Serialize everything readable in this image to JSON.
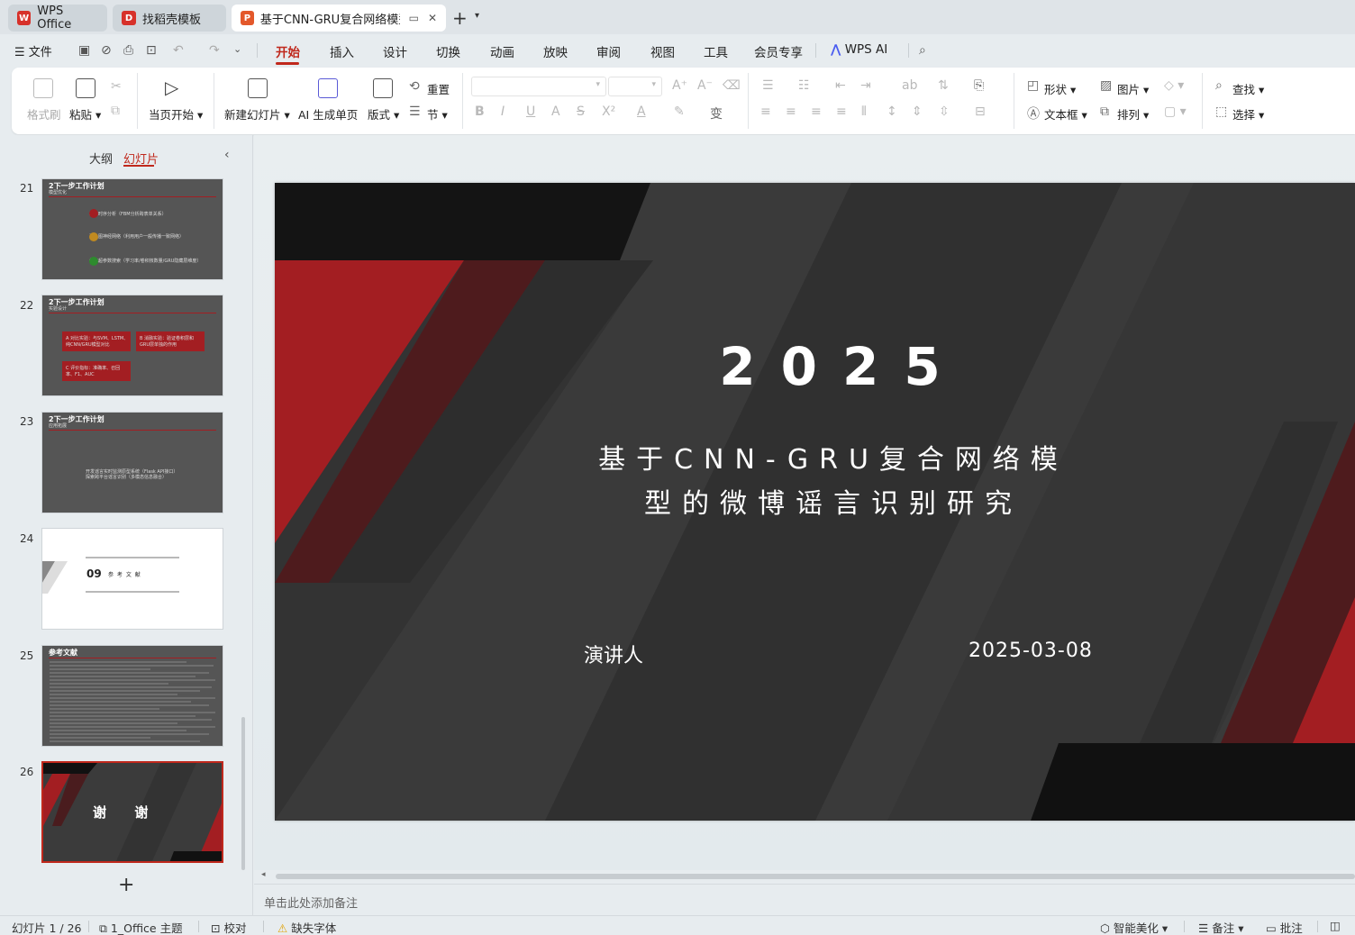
{
  "tabs": [
    {
      "label": "WPS Office",
      "icon": "wps-logo-icon",
      "color": "#d7312a"
    },
    {
      "label": "找稻壳模板",
      "icon": "docer-icon",
      "color": "#d7312a"
    },
    {
      "label": "基于CNN-GRU复合网络模型",
      "icon": "presentation-icon",
      "color": "#e3582b",
      "active": true
    }
  ],
  "menu": {
    "file": "文件",
    "items": [
      "开始",
      "插入",
      "设计",
      "切换",
      "动画",
      "放映",
      "审阅",
      "视图",
      "工具",
      "会员专享"
    ],
    "active": "开始",
    "ai": "WPS AI"
  },
  "ribbon": {
    "format_painter": "格式刷",
    "paste": "粘贴",
    "play_from_current": "当页开始",
    "new_slide": "新建幻灯片",
    "ai_generate": "AI 生成单页",
    "layout": "版式",
    "reset": "重置",
    "section": "节",
    "shape": "形状",
    "picture": "图片",
    "textbox": "文本框",
    "arrange": "排列",
    "find": "查找",
    "select": "选择"
  },
  "left_panel": {
    "tab_outline": "大纲",
    "tab_slides": "幻灯片",
    "thumbnails": [
      {
        "num": "21",
        "title": "2下一步工作计划",
        "sub": "模型优化",
        "items": [
          "增加时序分析（FBM分析跨表单关系）",
          "引入图神经网络（利用用户一般传播一致网络）",
          "优化超参数搜索（学习率/卷积核数量/GRU隐藏层维度）"
        ]
      },
      {
        "num": "22",
        "title": "2下一步工作计划",
        "sub": "实验设计",
        "boxes": [
          "A 对比实验：与SVM、LSTM、纯CNN/GRU模型对比",
          "B 消融实验：验证卷积层和GRU层单独的作用",
          "C 评价指标：准确率、召回率、F1、AUC"
        ]
      },
      {
        "num": "23",
        "title": "2下一步工作计划",
        "sub": "应用拓展",
        "items": [
          "开发谣言实时监测原型系统（Flask API接口）",
          "探索跨平台谣言识别（多模态信息融合）"
        ]
      },
      {
        "num": "24",
        "section_num": "09",
        "section_title": "参 考 文 献"
      },
      {
        "num": "25",
        "title": "参考文献"
      },
      {
        "num": "26",
        "thanks": "谢      谢"
      }
    ],
    "add": "+"
  },
  "slide": {
    "year": "2025",
    "title_line1": "基于CNN-GRU复合网络模",
    "title_line2": "型的微博谣言识别研究",
    "speaker": "演讲人",
    "date": "2025-03-08"
  },
  "notes_placeholder": "单击此处添加备注",
  "status": {
    "slide_counter": "幻灯片 1 / 26",
    "theme": "1_Office 主题",
    "proofread": "校对",
    "missing_font": "缺失字体",
    "smart_beautify": "智能美化",
    "notes": "备注",
    "comments": "批注"
  },
  "colors": {
    "accent": "#c0281c",
    "slide_red": "#a31e22",
    "slide_dark": "#3b3b3b"
  }
}
